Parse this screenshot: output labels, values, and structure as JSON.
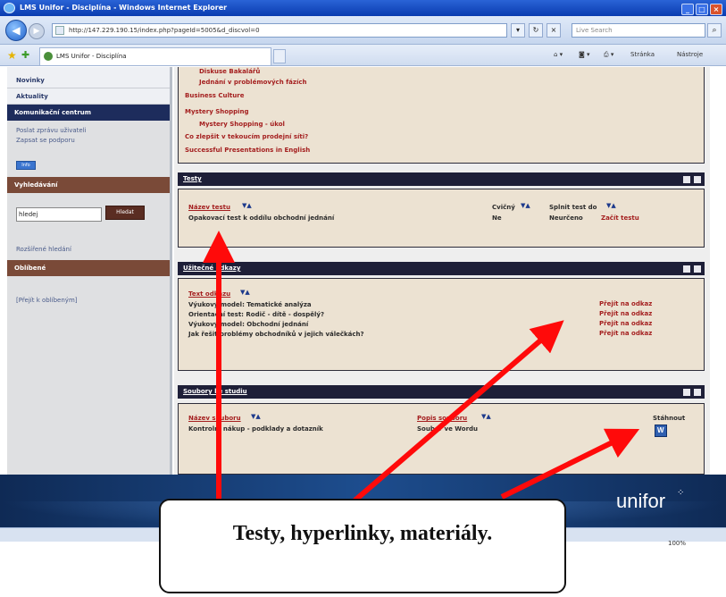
{
  "window": {
    "title": "LMS Unifor - Disciplína - Windows Internet Explorer",
    "address": "http://147.229.190.15/index.php?pageId=5005&d_discvol=0",
    "search_placeholder": "Live Search",
    "tab_title": "LMS Unifor - Disciplína",
    "commands": [
      "Stránka",
      "Nástroje"
    ],
    "zoom": "100%"
  },
  "sidebar": {
    "items": [
      "Novinky",
      "Aktuality"
    ],
    "comm_header": "Komunikační centrum",
    "comm_links": [
      "Poslat zprávu uživateli",
      "Zapsat se podporu"
    ],
    "comm_button": "Info",
    "search_header": "Vyhledávání",
    "search_value": "hledej",
    "search_button": "Hledat",
    "search_link": "Rozšířené hledání",
    "help_header": "Oblíbené",
    "help_link": "[Přejít k oblíbeným]"
  },
  "top_links": [
    "Diskuse Bakalářů",
    "Jednání v problémových fázích",
    "Business Culture",
    "Mystery Shopping",
    "Mystery Shopping - úkol",
    "Co zlepšit v tekoucím prodejní síti?",
    "Successful Presentations in English"
  ],
  "tests": {
    "title": "Testy",
    "col_name": "Název testu",
    "col_practice": "Cvičný",
    "col_done": "Splnit test do",
    "row_name": "Opakovací test k oddílu obchodní jednání",
    "row_practice": "Ne",
    "row_done": "Neurčeno",
    "row_action": "Začít testu"
  },
  "links": {
    "title": "Užitečné odkazy",
    "col_name": "Text odkazu",
    "rows": [
      "Výukový model: Tematické analýza",
      "Orientační test: Rodič - dítě - dospělý?",
      "Výukový model: Obchodní jednání",
      "Jak řešit problémy obchodníků v jejich válečkách?"
    ],
    "action": "Přejít na odkaz"
  },
  "materials": {
    "title": "Soubory ke studiu",
    "col_name": "Název souboru",
    "col_desc": "Popis souboru",
    "col_download": "Stáhnout",
    "row_name": "Kontrolní nákup - podklady a dotazník",
    "row_desc": "Soubor ve Wordu"
  },
  "footer": {
    "logo": "unifor"
  },
  "annotation": {
    "text": "Testy, hyperlinky, materiály."
  }
}
